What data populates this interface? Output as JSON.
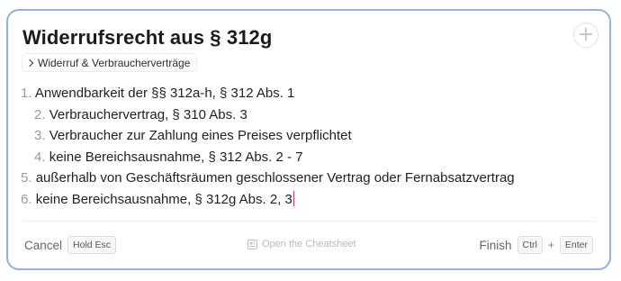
{
  "dialog": {
    "title": "Widerrufsrecht aus § 312g",
    "add_icon_glyph": "+",
    "breadcrumb": "Widerruf & Verbraucherverträge"
  },
  "outline": [
    {
      "num": "1.",
      "text": "Anwendbarkeit der §§ 312a-h, § 312 Abs. 1",
      "indent": 0
    },
    {
      "num": "2.",
      "text": "Verbrauchervertrag, § 310 Abs. 3",
      "indent": 1
    },
    {
      "num": "3.",
      "text": "Verbraucher zur Zahlung eines Preises verpflichtet",
      "indent": 1
    },
    {
      "num": "4.",
      "text": "keine Bereichsausnahme, § 312 Abs. 2 - 7",
      "indent": 1
    },
    {
      "num": "5.",
      "text": "außerhalb von Geschäftsräumen geschlossener Vertrag oder Fernabsatzvertrag",
      "indent": 0
    },
    {
      "num": "6.",
      "text": "keine Bereichsausnahme, § 312g Abs. 2, 3",
      "indent": 0
    }
  ],
  "footer": {
    "cancel_label": "Cancel",
    "cancel_key": "Hold Esc",
    "cheatsheet_label": "Open the Cheatsheet",
    "finish_label": "Finish",
    "finish_key1": "Ctrl",
    "finish_plus": "+",
    "finish_key2": "Enter"
  },
  "colors": {
    "border_accent": "#8fb3e3",
    "caret": "#d6336c"
  }
}
